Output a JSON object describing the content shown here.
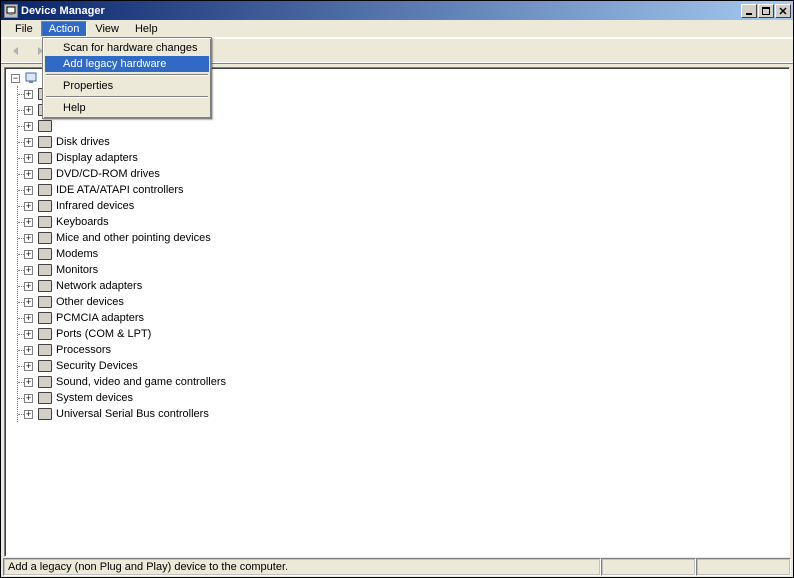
{
  "window": {
    "title": "Device Manager"
  },
  "menubar": {
    "items": [
      "File",
      "Action",
      "View",
      "Help"
    ],
    "openIndex": 1
  },
  "dropdown": {
    "items": [
      {
        "label": "Scan for hardware changes",
        "highlighted": false
      },
      {
        "label": "Add legacy hardware",
        "highlighted": true
      }
    ],
    "items2": [
      {
        "label": "Properties"
      }
    ],
    "items3": [
      {
        "label": "Help"
      }
    ]
  },
  "tree": {
    "root": {
      "label": ""
    },
    "items": [
      {
        "label": ""
      },
      {
        "label": ""
      },
      {
        "label": ""
      },
      {
        "label": "Disk drives"
      },
      {
        "label": "Display adapters"
      },
      {
        "label": "DVD/CD-ROM drives"
      },
      {
        "label": "IDE ATA/ATAPI controllers"
      },
      {
        "label": "Infrared devices"
      },
      {
        "label": "Keyboards"
      },
      {
        "label": "Mice and other pointing devices"
      },
      {
        "label": "Modems"
      },
      {
        "label": "Monitors"
      },
      {
        "label": "Network adapters"
      },
      {
        "label": "Other devices"
      },
      {
        "label": "PCMCIA adapters"
      },
      {
        "label": "Ports (COM & LPT)"
      },
      {
        "label": "Processors"
      },
      {
        "label": "Security Devices"
      },
      {
        "label": "Sound, video and game controllers"
      },
      {
        "label": "System devices"
      },
      {
        "label": "Universal Serial Bus controllers"
      }
    ]
  },
  "statusbar": {
    "text": "Add a legacy (non Plug and Play) device to the computer."
  }
}
